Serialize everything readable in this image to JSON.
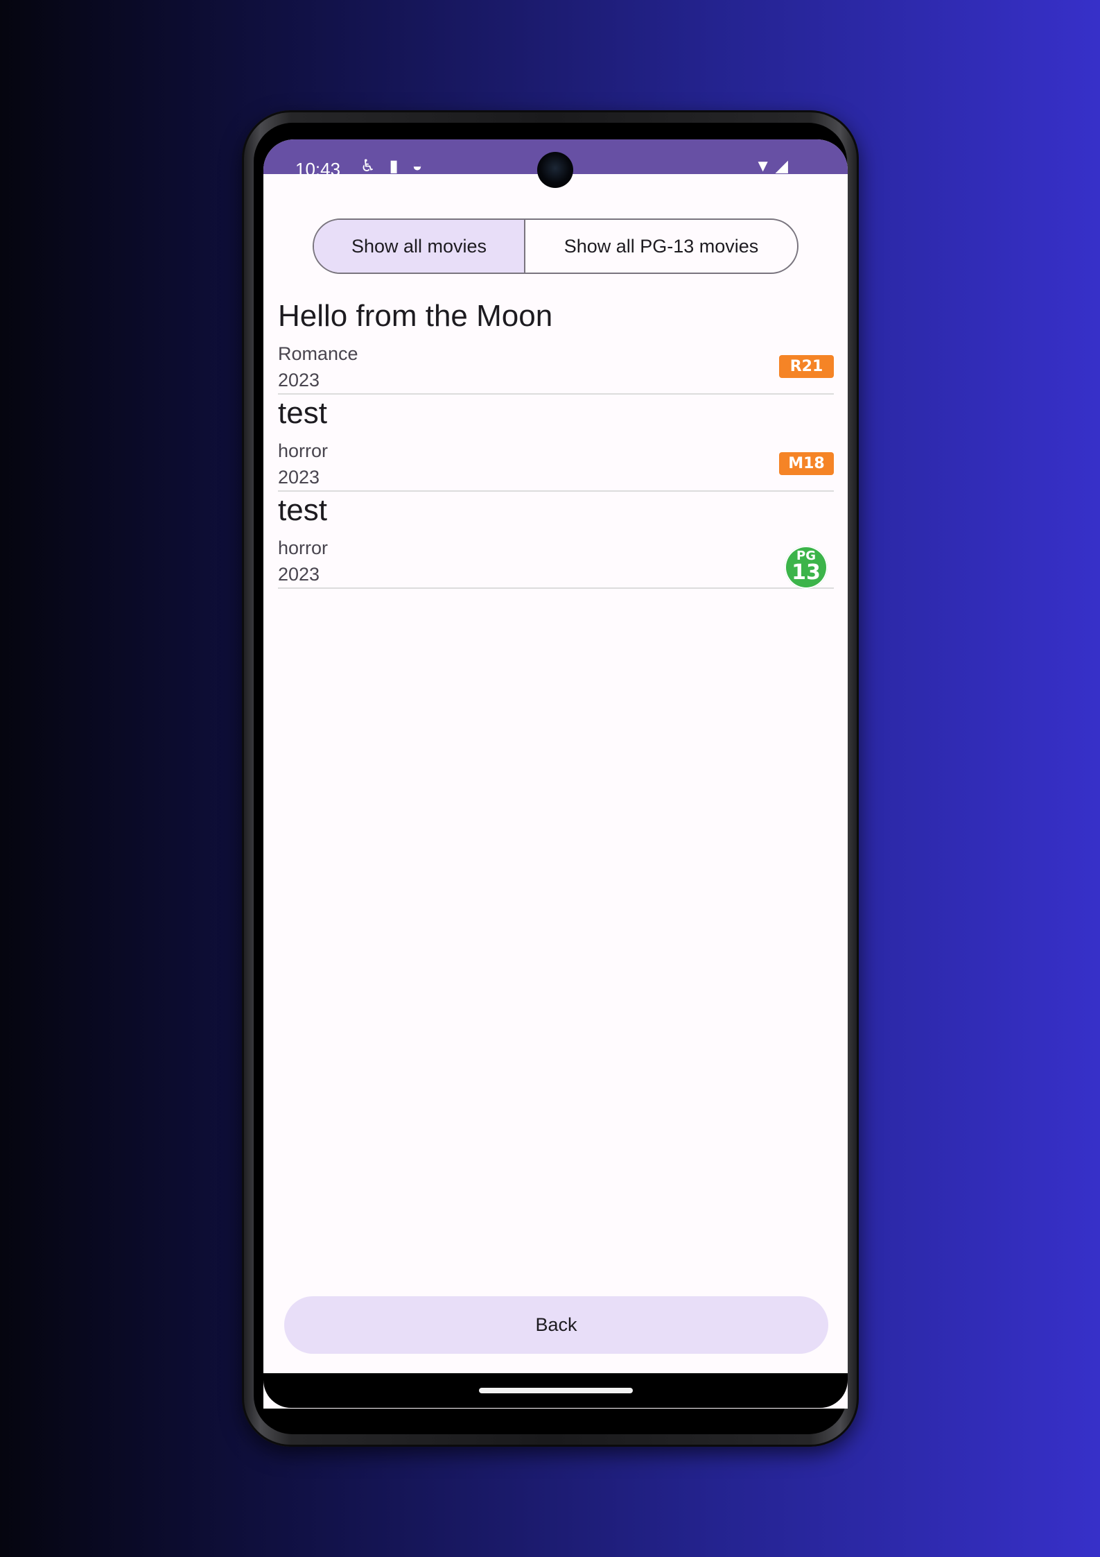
{
  "status_bar": {
    "time": "10:43",
    "left_icons": [
      "accessibility-icon",
      "sd-card-icon",
      "face-icon"
    ],
    "right_icons": [
      "wifi-icon",
      "signal-icon"
    ],
    "color": "#6750a4"
  },
  "filter": {
    "show_all_label": "Show all movies",
    "show_pg13_label": "Show all PG-13 movies",
    "selected": "Show all movies"
  },
  "movies": [
    {
      "title": "Hello from the Moon",
      "genre": "Romance",
      "year": "2023",
      "rating": "R21",
      "rating_color": "#f58426"
    },
    {
      "title": "test",
      "genre": "horror",
      "year": "2023",
      "rating": "M18",
      "rating_color": "#f58426"
    },
    {
      "title": "test",
      "genre": "horror",
      "year": "2023",
      "rating_pg": "PG",
      "rating_num": "13",
      "rating_color": "#3cb44a"
    }
  ],
  "back_label": "Back"
}
